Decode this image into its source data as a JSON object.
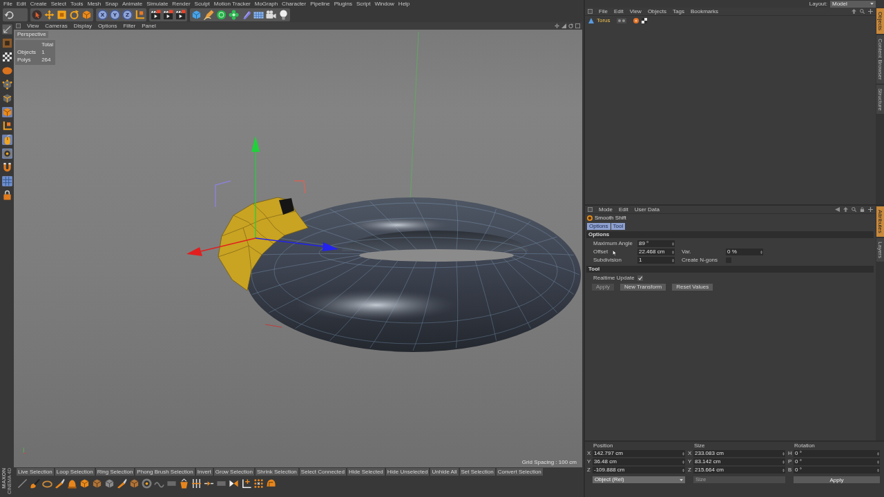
{
  "menu_bar": {
    "items": [
      "File",
      "Edit",
      "Create",
      "Select",
      "Tools",
      "Mesh",
      "Snap",
      "Animate",
      "Simulate",
      "Render",
      "Sculpt",
      "Motion Tracker",
      "MoGraph",
      "Character",
      "Pipeline",
      "Plugins",
      "Script",
      "Window",
      "Help"
    ]
  },
  "main_toolbar": {
    "groups": [
      {
        "items": [
          {
            "kind": "undo",
            "selected": false
          }
        ]
      },
      {
        "items": [
          {
            "kind": "cursor",
            "selected": false
          },
          {
            "kind": "move",
            "selected": false
          },
          {
            "kind": "scale",
            "selected": false
          },
          {
            "kind": "rotate",
            "selected": false
          },
          {
            "kind": "cube",
            "selected": false
          }
        ]
      },
      {
        "items": [
          {
            "kind": "lock",
            "label": "X",
            "selected": true
          },
          {
            "kind": "lock",
            "label": "Y",
            "selected": true
          },
          {
            "kind": "lock",
            "label": "Z",
            "selected": true
          },
          {
            "kind": "axes",
            "selected": false
          }
        ]
      },
      {
        "items": [
          {
            "kind": "clapboard",
            "selected": false
          },
          {
            "kind": "clapboard",
            "selected": false
          },
          {
            "kind": "clapboard",
            "selected": false
          }
        ]
      },
      {
        "items": [
          {
            "kind": "primitive",
            "selected": false
          },
          {
            "kind": "pen",
            "selected": false
          },
          {
            "kind": "sphere",
            "selected": false
          },
          {
            "kind": "flower",
            "selected": false
          },
          {
            "kind": "capsule",
            "selected": false
          },
          {
            "kind": "tiles",
            "selected": false
          },
          {
            "kind": "camera",
            "selected": false
          },
          {
            "kind": "bulb",
            "selected": false
          }
        ]
      }
    ]
  },
  "left_toolbar": {
    "items": [
      {
        "kind": "ruler",
        "selected": false
      },
      {
        "kind": "box",
        "selected": false
      },
      {
        "kind": "checker",
        "selected": false
      },
      {
        "kind": "blob",
        "selected": false
      },
      {
        "kind": "points",
        "selected": false
      },
      {
        "kind": "edges",
        "selected": false
      },
      {
        "kind": "cube",
        "selected": true
      },
      {
        "kind": "axes",
        "selected": false
      },
      {
        "kind": "mouse",
        "selected": true
      },
      {
        "kind": "disc",
        "selected": true
      },
      {
        "kind": "magnet",
        "selected": false
      },
      {
        "kind": "grid",
        "selected": true
      },
      {
        "kind": "padlock",
        "selected": false
      }
    ]
  },
  "viewport": {
    "menu": [
      "View",
      "Cameras",
      "Display",
      "Options",
      "Filter",
      "Panel"
    ],
    "camera": "Perspective",
    "hud": {
      "header": "Total",
      "rows": [
        {
          "label": "Objects",
          "value": "1"
        },
        {
          "label": "Polys",
          "value": "264"
        }
      ]
    },
    "grid_spacing": "Grid Spacing : 100 cm"
  },
  "command_bar": {
    "buttons": [
      "Live Selection",
      "Loop Selection",
      "Ring Selection",
      "Phong Brush Selection",
      "Invert",
      "Grow Selection",
      "Shrink Selection",
      "Select Connected",
      "Hide Selected",
      "Hide Unselected",
      "Unhide All",
      "Set Selection",
      "Convert Selection"
    ]
  },
  "bottom_toolbar": {
    "items": [
      {
        "kind": "line"
      },
      {
        "kind": "brush"
      },
      {
        "kind": "ring"
      },
      {
        "kind": "knife"
      },
      {
        "kind": "bell"
      },
      {
        "kind": "cube"
      },
      {
        "kind": "hexcube"
      },
      {
        "kind": "graycube"
      },
      {
        "kind": "knife"
      },
      {
        "kind": "hexcube"
      },
      {
        "kind": "disc"
      },
      {
        "kind": "wave"
      },
      {
        "kind": "slab"
      },
      {
        "kind": "bucket"
      },
      {
        "kind": "bars"
      },
      {
        "kind": "arrows"
      },
      {
        "kind": "slab"
      },
      {
        "kind": "play"
      },
      {
        "kind": "corner"
      },
      {
        "kind": "dots"
      },
      {
        "kind": "helmet"
      }
    ]
  },
  "brand": {
    "lines": [
      "MAXON",
      "CINEMA 4D"
    ]
  },
  "layout_selector": {
    "label": "Layout:",
    "value": "Model"
  },
  "object_manager": {
    "menu": [
      "File",
      "Edit",
      "View",
      "Objects",
      "Tags",
      "Bookmarks"
    ],
    "objects": [
      {
        "name": "Torus",
        "selected": true
      }
    ]
  },
  "side_tabs_top": [
    {
      "label": "Objects",
      "selected": true
    },
    {
      "label": "Content Browser",
      "selected": false
    },
    {
      "label": "Structure",
      "selected": false
    }
  ],
  "attribute_manager": {
    "menu": [
      "Mode",
      "Edit",
      "User Data"
    ],
    "title": "Smooth Shift",
    "tabs": [
      {
        "label": "Options",
        "selected": true
      },
      {
        "label": "Tool",
        "selected": true
      }
    ],
    "sections": [
      {
        "title": "Options",
        "rows": [
          [
            {
              "kind": "number",
              "label": "Maximum Angle",
              "value": "89 °"
            }
          ],
          [
            {
              "kind": "number",
              "label": "Offset",
              "value": "22.468 cm"
            },
            {
              "kind": "number",
              "label": "Var.",
              "value": "0 %"
            }
          ],
          [
            {
              "kind": "number",
              "label": "Subdivision",
              "value": "1"
            },
            {
              "kind": "checkbox",
              "label": "Create N-gons",
              "checked": false
            }
          ]
        ]
      },
      {
        "title": "Tool",
        "rows": [
          [
            {
              "kind": "checkbox",
              "label": "Realtime Update",
              "checked": true
            }
          ]
        ],
        "buttons": [
          {
            "label": "Apply",
            "disabled": true
          },
          {
            "label": "New Transform",
            "disabled": false
          },
          {
            "label": "Reset Values",
            "disabled": false
          }
        ]
      }
    ]
  },
  "side_tabs_bottom": [
    {
      "label": "Attributes",
      "selected": true
    },
    {
      "label": "Layers",
      "selected": false
    }
  ],
  "coordinates": {
    "columns": [
      {
        "title": "Position",
        "fields": [
          {
            "axis": "X",
            "value": "142.797 cm"
          },
          {
            "axis": "Y",
            "value": "36.48 cm"
          },
          {
            "axis": "Z",
            "value": "-109.888 cm"
          }
        ],
        "control": {
          "kind": "dropdown",
          "label": "Object (Rel)",
          "disabled": false
        }
      },
      {
        "title": "Size",
        "fields": [
          {
            "axis": "X",
            "value": "233.083 cm"
          },
          {
            "axis": "Y",
            "value": "83.142 cm"
          },
          {
            "axis": "Z",
            "value": "215.664 cm"
          }
        ],
        "control": {
          "kind": "dropdown",
          "label": "Size",
          "disabled": true
        }
      },
      {
        "title": "Rotation",
        "fields": [
          {
            "axis": "H",
            "value": "0 °"
          },
          {
            "axis": "P",
            "value": "0 °"
          },
          {
            "axis": "B",
            "value": "0 °"
          }
        ],
        "control": {
          "kind": "button",
          "label": "Apply",
          "disabled": false
        }
      }
    ]
  }
}
